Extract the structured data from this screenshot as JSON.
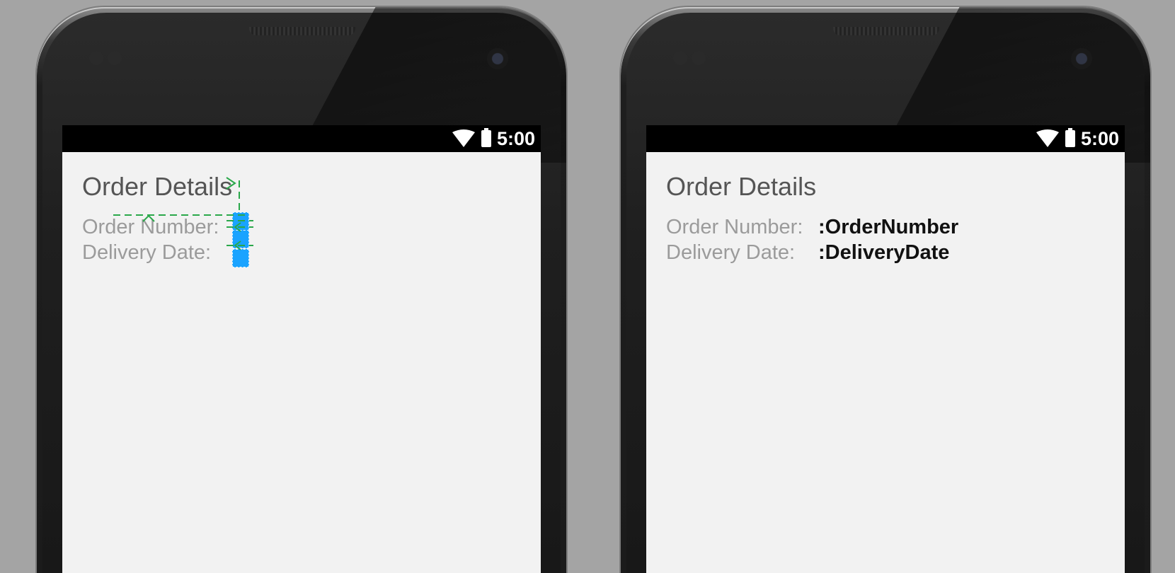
{
  "status_bar": {
    "time": "5:00"
  },
  "layout_preview": {
    "title": "Order Details",
    "order_number_label": "Order Number:",
    "delivery_date_label": "Delivery Date:"
  },
  "runtime_preview": {
    "title": "Order Details",
    "order_number_label": "Order Number:",
    "order_number_value": ":OrderNumber",
    "delivery_date_label": "Delivery Date:",
    "delivery_date_value": ":DeliveryDate"
  },
  "colors": {
    "background": "#a4a4a4",
    "screen": "#f2f2f2",
    "guide_green": "#2aa84a",
    "selection_blue": "#1aa3ff"
  }
}
